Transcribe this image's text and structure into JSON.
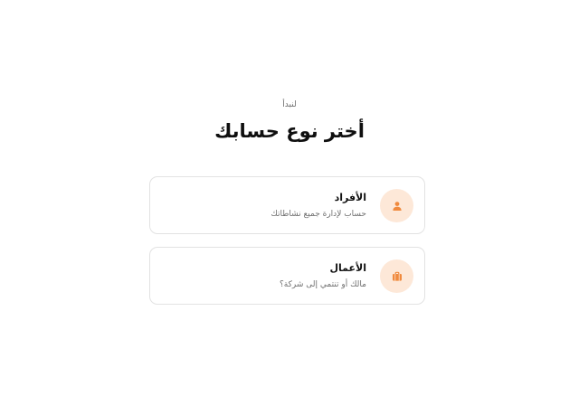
{
  "header": {
    "eyebrow": "لنبدأ",
    "title": "أختر نوع حسابك"
  },
  "accent_color": "#f08a3e",
  "icon_bg_color": "#fde8d8",
  "account_types": [
    {
      "title": "الأفراد",
      "description": "حساب لإدارة جميع نشاطاتك",
      "icon": "user-icon"
    },
    {
      "title": "الأعمال",
      "description": "مالك أو تنتمي إلى شركة؟",
      "icon": "briefcase-icon"
    }
  ]
}
